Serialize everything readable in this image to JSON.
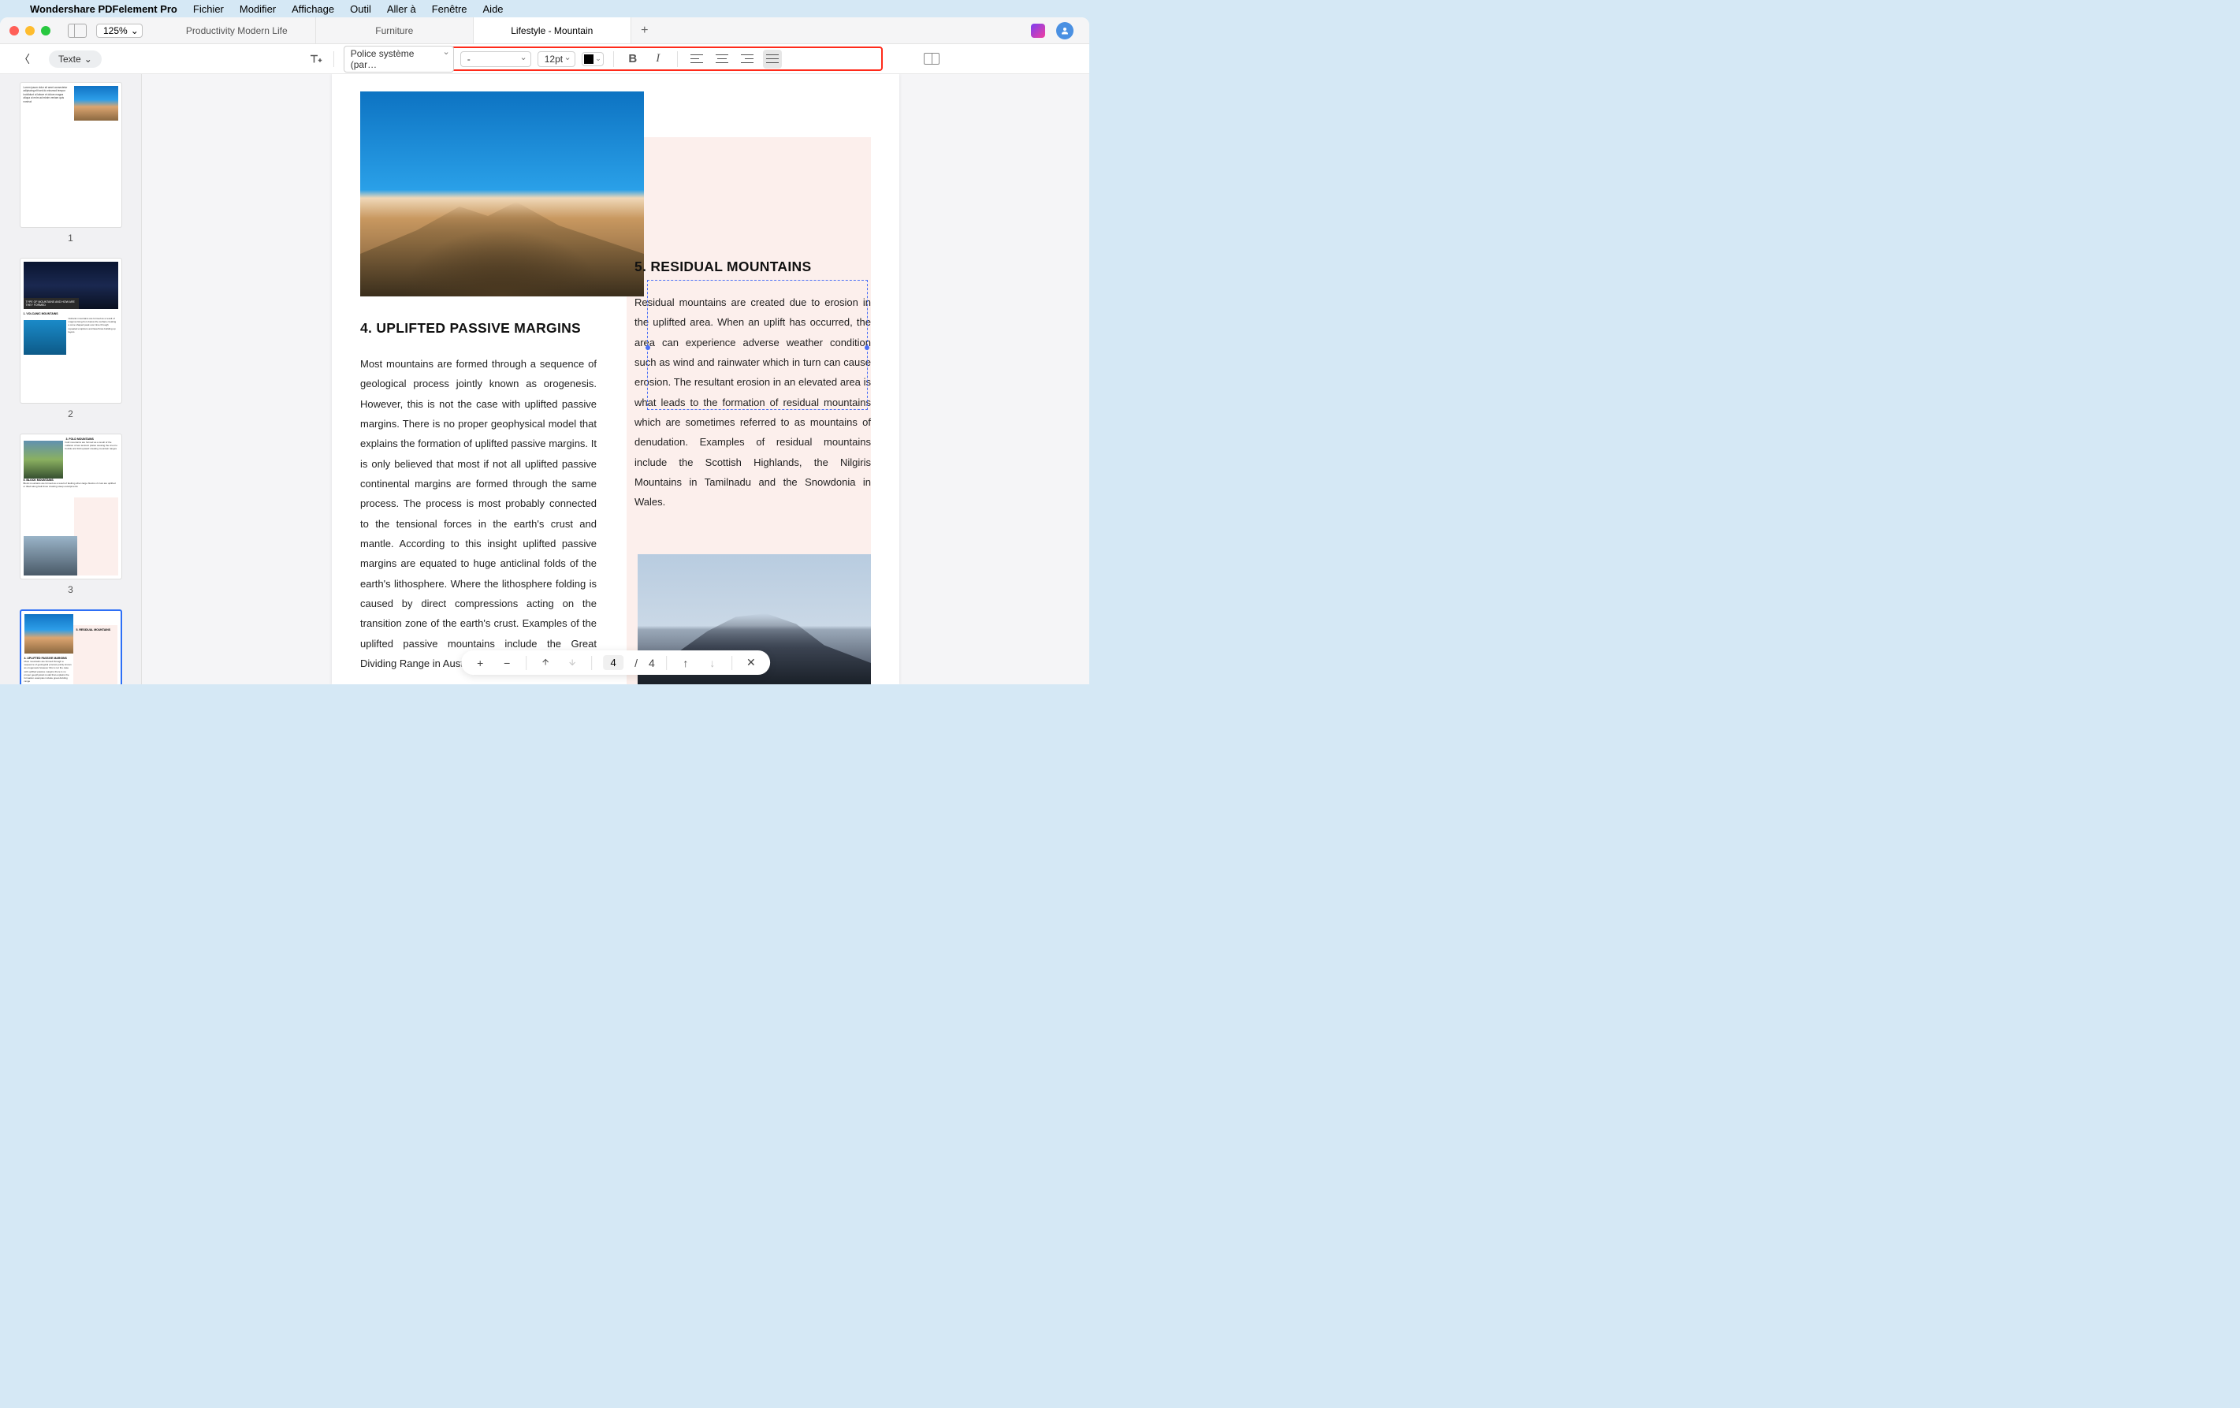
{
  "menubar": {
    "app_name": "Wondershare PDFelement Pro",
    "items": [
      "Fichier",
      "Modifier",
      "Affichage",
      "Outil",
      "Aller à",
      "Fenêtre",
      "Aide"
    ]
  },
  "titlebar": {
    "zoom": "125%",
    "tabs": [
      {
        "label": "Productivity Modern Life",
        "active": false
      },
      {
        "label": "Furniture",
        "active": false
      },
      {
        "label": "Lifestyle - Mountain",
        "active": true
      }
    ]
  },
  "toolbar": {
    "mode_label": "Texte",
    "font_family": "Police système (par…",
    "font_style": "-",
    "font_size": "12pt",
    "color_hex": "#000000"
  },
  "thumbnails": {
    "pages": [
      {
        "num": "1"
      },
      {
        "num": "2",
        "band": "TYPE OF MOUNTAINS AND HOW ARE THEY FORMED",
        "sub": "1. VOLCANIC MOUNTAINS"
      },
      {
        "num": "3",
        "h1": "3. FOLD MOUNTAINS",
        "h2": "5. BLOCK MOUNTAINS"
      },
      {
        "num": "4",
        "h1": "5. RESIDUAL MOUNTAINS",
        "h2": "4. UPLIFTED PASSIVE MARGINS",
        "selected": true
      }
    ]
  },
  "document": {
    "section4": {
      "heading": "4. UPLIFTED PASSIVE MARGINS",
      "body": "Most mountains are formed through a sequence of geological process jointly known as orogenesis. However, this is not the case with uplifted passive margins. There is no proper geophysical model that explains the formation of uplifted passive margins. It is only believed that most if not all uplifted passive continental margins are formed through the same process. The process is most probably connected to the tensional forces in the earth's crust and mantle. According to this insight uplifted passive margins are equated to huge anticlinal folds of the earth's lithosphere. Where the lithosphere folding is caused by direct compressions acting on the transition zone of the earth's crust. Examples of the uplifted passive mountains include the Great Dividing Range in Australia, the Scandinavian"
    },
    "section5": {
      "heading": "5. RESIDUAL MOUNTAINS",
      "body": "Residual mountains are created due to erosion in the uplifted area. When an uplift has occurred, the area can experience adverse weather condition such as wind and rainwater which in turn can cause erosion. The resultant erosion in an elevated area is what leads to the formation of residual mountains which are sometimes referred to as mountains of denudation. Examples of residual mountains include the Scottish Highlands, the Nilgiris Mountains in Tamilnadu and the Snowdonia in Wales."
    }
  },
  "pagenav": {
    "current": "4",
    "total": "4",
    "separator": "/"
  }
}
